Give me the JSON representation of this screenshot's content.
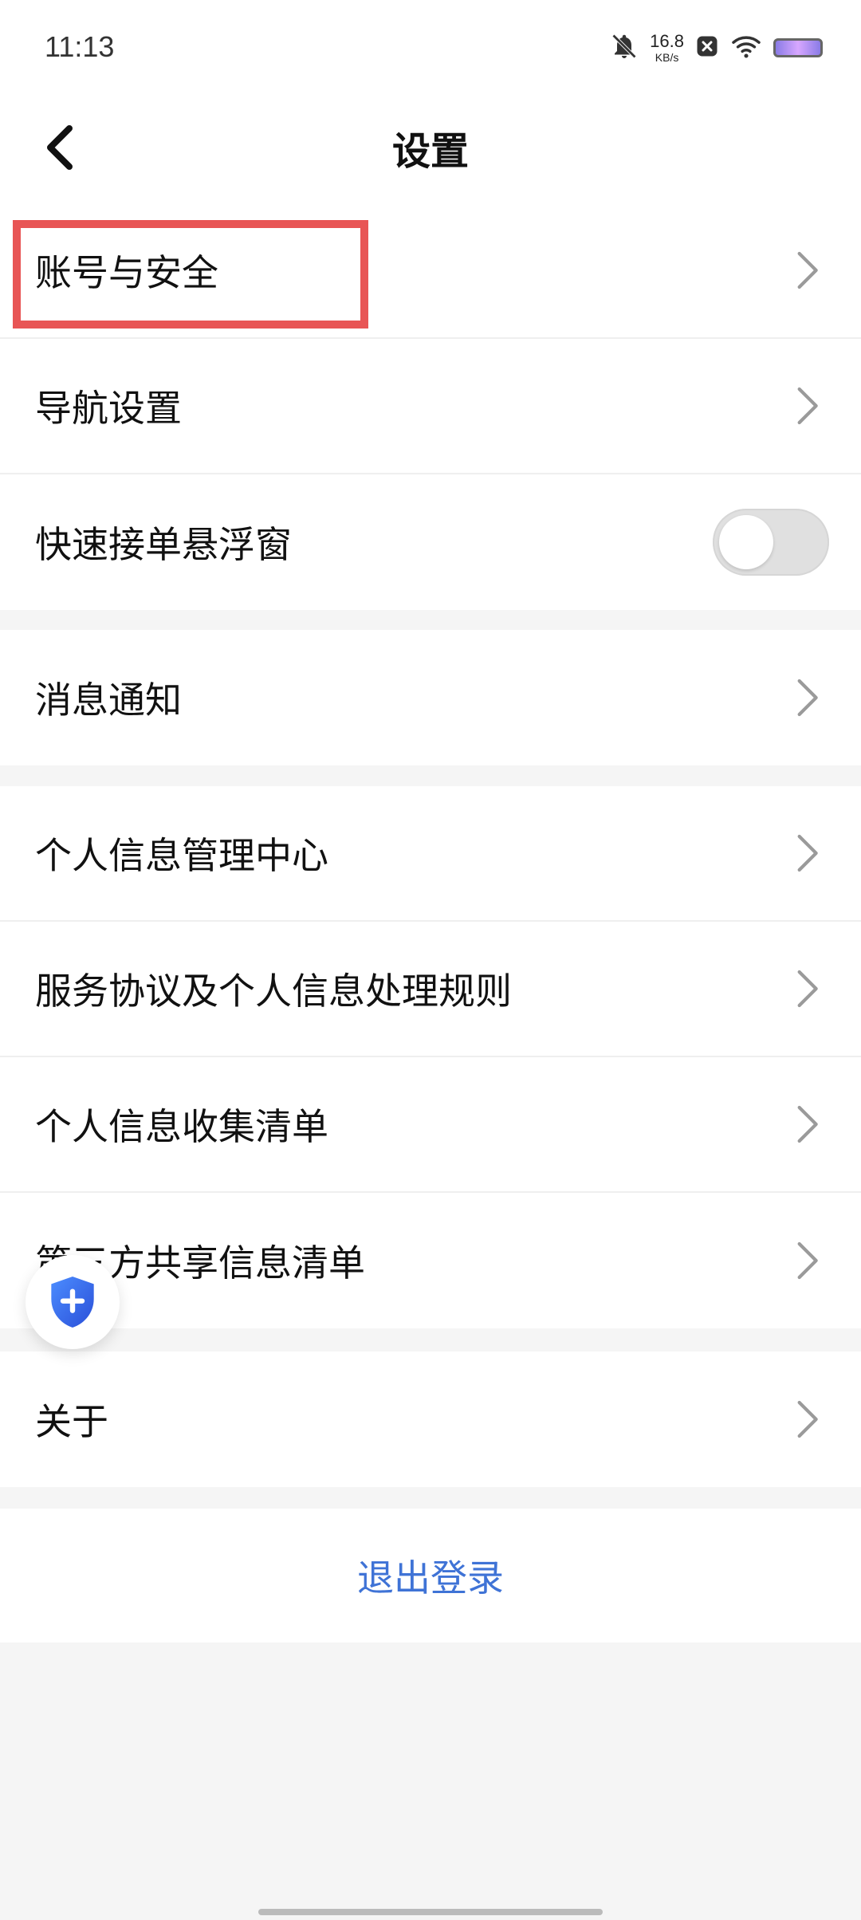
{
  "status_bar": {
    "time": "11:13",
    "net_speed_value": "16.8",
    "net_speed_unit": "KB/s",
    "icons": [
      "bell-off-icon",
      "close-box-icon",
      "wifi-icon",
      "battery-icon"
    ]
  },
  "header": {
    "title": "设置",
    "back_icon": "chevron-left-icon"
  },
  "settings": {
    "group1": [
      {
        "label": "账号与安全",
        "type": "chevron"
      },
      {
        "label": "导航设置",
        "type": "chevron"
      },
      {
        "label": "快速接单悬浮窗",
        "type": "toggle",
        "checked": false
      }
    ],
    "group2": [
      {
        "label": "消息通知",
        "type": "chevron"
      }
    ],
    "group3": [
      {
        "label": "个人信息管理中心",
        "type": "chevron"
      },
      {
        "label": "服务协议及个人信息处理规则",
        "type": "chevron"
      },
      {
        "label": "个人信息收集清单",
        "type": "chevron"
      },
      {
        "label": "第三方共享信息清单",
        "type": "chevron"
      }
    ],
    "group4": [
      {
        "label": "关于",
        "type": "chevron"
      }
    ]
  },
  "logout": {
    "label": "退出登录",
    "color": "#3f73d6"
  },
  "highlight_color": "#e85555",
  "floating_widget_icon": "shield-plus-icon"
}
